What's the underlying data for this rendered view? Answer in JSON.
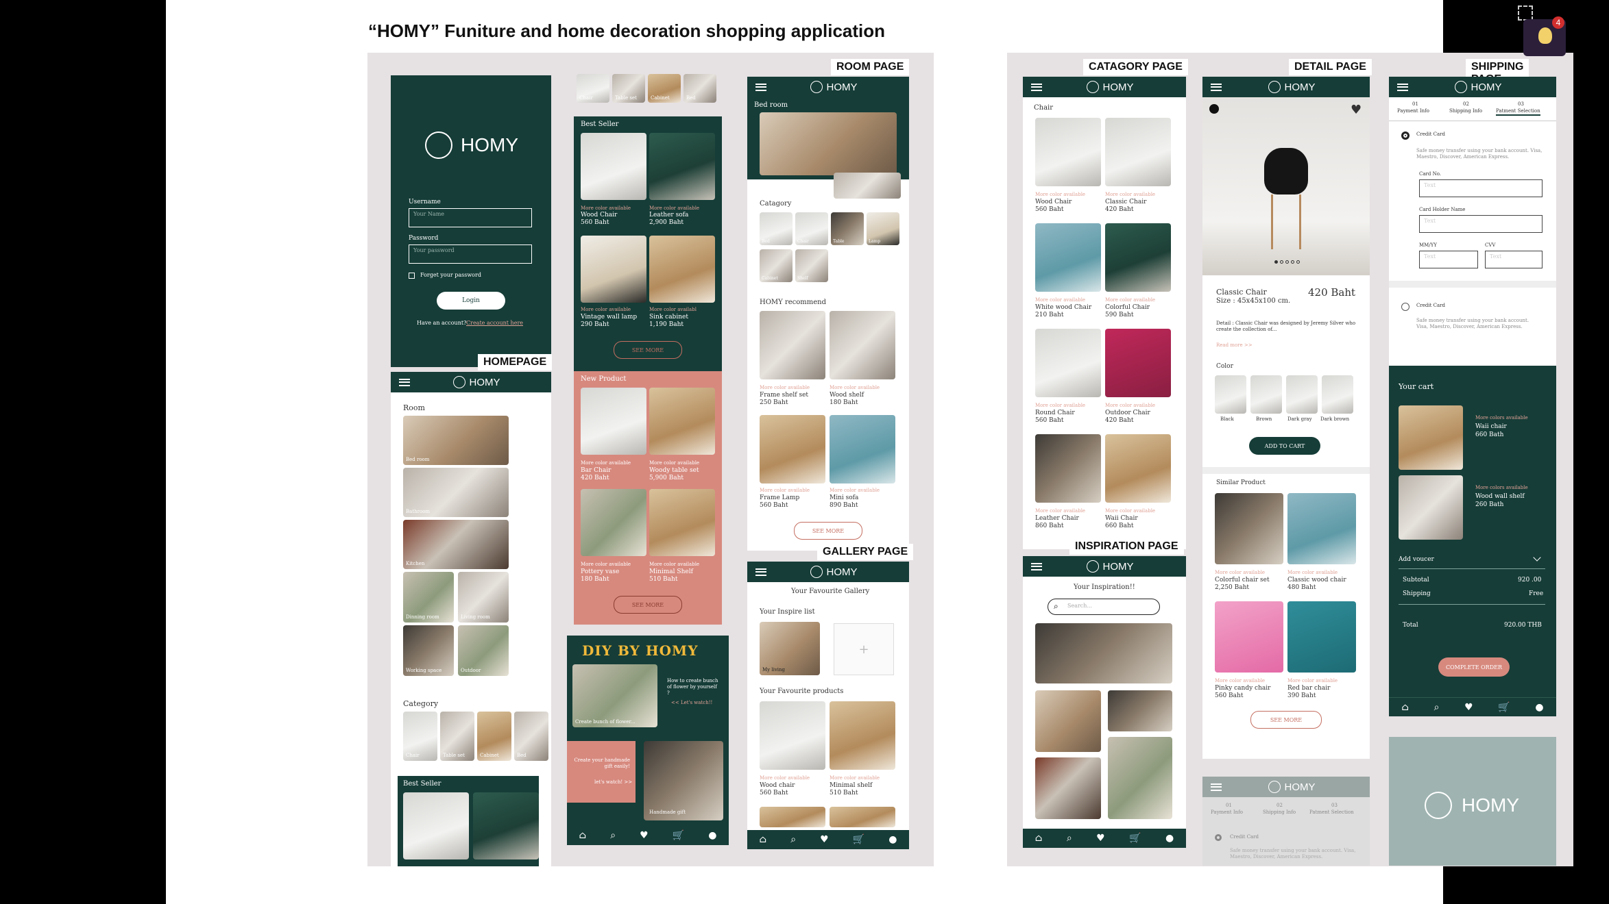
{
  "headline": "“HOMY” Funiture and home decoration shopping application",
  "brand": "HOMY",
  "notification_count": "4",
  "icons": {
    "menu": "☰",
    "home": "⌂",
    "search": "⌕",
    "heart": "♥",
    "cart": "🛒",
    "user": "●"
  },
  "tags": {
    "homepage": "HOMEPAGE",
    "room": "ROOM PAGE",
    "gallery": "GALLERY PAGE",
    "category": "CATAGORY  PAGE",
    "detail": "DETAIL PAGE",
    "shipping": "SHIPPING PAGE",
    "inspiration": "INSPIRATION PAGE"
  },
  "login": {
    "username_label": "Username",
    "username_placeholder": "Your Name",
    "password_label": "Password",
    "password_placeholder": "Your password",
    "remember": "Forget your password",
    "login_button": "Login",
    "no_account": "Have an account?",
    "create": "Create account here"
  },
  "home": {
    "room_title": "Room",
    "rooms": [
      "Bed room",
      "Bathroom",
      "Kitchen",
      "Dinning room",
      "Living room",
      "Working space",
      "Outdoor"
    ],
    "category_title": "Category",
    "categories": [
      "Chair",
      "Table set",
      "Cabinet",
      "Bed"
    ],
    "best_seller": "Best Seller"
  },
  "col2": {
    "top_categories": [
      "Chair",
      "Table set",
      "Cabinet",
      "Bed"
    ],
    "best_seller": "Best Seller",
    "more_color": "More color available",
    "more_color_short": "More color availabl",
    "bs_items": [
      {
        "name": "Wood Chair",
        "price": "560 Baht"
      },
      {
        "name": "Leather sofa",
        "price": "2,900 Baht"
      },
      {
        "name": "Vintage wall lamp",
        "price": "290 Baht"
      },
      {
        "name": "Sink cabinet",
        "price": "1,190 Baht"
      }
    ],
    "see_more": "SEE MORE",
    "new_product": "New Product",
    "np_items": [
      {
        "name": "Bar Chair",
        "price": "420 Baht"
      },
      {
        "name": "Woody table set",
        "price": "5,900 Baht"
      },
      {
        "name": "Pottery vase",
        "price": "180 Baht"
      },
      {
        "name": "Minimal Shelf",
        "price": "510 Baht"
      }
    ],
    "diy_title": "DIY BY HOMY",
    "diy_flower": "Create bunch of flower...",
    "diy_how": "How to create bunch of flower by yourself ?",
    "diy_watch": "<< Let's watch!!",
    "diy_gift": "Create your handmade gift easily!",
    "diy_gift_link": "let's watch! >>",
    "handmade": "Handmade gift"
  },
  "roompage": {
    "title": "Bed room",
    "category_title": "Catagory",
    "categories": [
      "Bed",
      "Chair",
      "Table",
      "Lamp",
      "Cabinet",
      "Shelf"
    ],
    "recommend_title": "HOMY recommend",
    "items": [
      {
        "name": "Frame shelf set",
        "price": "250 Baht"
      },
      {
        "name": "Wood shelf",
        "price": "180 Baht"
      },
      {
        "name": "Frame Lamp",
        "price": "560 Baht"
      },
      {
        "name": "Mini sofa",
        "price": "890 Baht"
      }
    ]
  },
  "gallery": {
    "title": "Your Favourite Gallery",
    "inspire_list": "Your Inspire list",
    "my_living": "My living",
    "fav_products": "Your Favourite products",
    "items": [
      {
        "name": "Wood chair",
        "price": "560 Baht"
      },
      {
        "name": "Minimal shelf",
        "price": "510 Baht"
      }
    ]
  },
  "category": {
    "title": "Chair",
    "items": [
      {
        "name": "Wood Chair",
        "price": "560 Baht"
      },
      {
        "name": "Classic Chair",
        "price": "420 Baht"
      },
      {
        "name": "White wood Chair",
        "price": "210 Baht"
      },
      {
        "name": "Colorful Chair",
        "price": "590 Baht"
      },
      {
        "name": "Round Chair",
        "price": "560 Baht"
      },
      {
        "name": "Outdoor Chair",
        "price": "420 Baht"
      },
      {
        "name": "Leather Chair",
        "price": "860 Baht"
      },
      {
        "name": "Waii Chair",
        "price": "660 Baht"
      }
    ]
  },
  "inspiration": {
    "title": "Your Inspiration!!",
    "search_placeholder": "Search..."
  },
  "detail": {
    "name": "Classic Chair",
    "price": "420 Baht",
    "size": "Size : 45x45x100 cm.",
    "desc": "Detail : Classic Chair was designed by Jeremy Silver who create the collection of...",
    "read_more": "Read more >>",
    "color_title": "Color",
    "colors": [
      "Black",
      "Brown",
      "Dark gray",
      "Dark brown"
    ],
    "add_to_cart": "ADD TO CART",
    "similar_title": "Similar Product",
    "similar": [
      {
        "name": "Colorful chair set",
        "price": "2,250 Baht"
      },
      {
        "name": "Classic wood chair",
        "price": "480 Baht"
      },
      {
        "name": "Pinky candy chair",
        "price": "560 Baht"
      },
      {
        "name": "Red bar chair",
        "price": "390 Baht"
      }
    ]
  },
  "shipping": {
    "steps": [
      {
        "num": "01",
        "label": "Payment Info"
      },
      {
        "num": "02",
        "label": "Shipping Info"
      },
      {
        "num": "03",
        "label": "Patment Selection"
      }
    ],
    "credit": "Credit Card",
    "credit_desc": "Safe money transfer using your bank account. Visa, Maestro, Discover, American Express.",
    "card_no": "Card No.",
    "card_holder": "Card Holder Name",
    "mmyy": "MM/YY",
    "cvv": "CVV",
    "input_hint": "Text",
    "cart_title": "Your cart",
    "cart_more": "More colors available",
    "cart_items": [
      {
        "name": "Waii chair",
        "price": "660 Bath"
      },
      {
        "name": "Wood wall shelf",
        "price": "260 Bath"
      }
    ],
    "voucher": "Add voucer",
    "subtotal_label": "Subtotal",
    "subtotal": "920 .00",
    "shipping_label": "Shipping",
    "shipping_val": "Free",
    "total_label": "Total",
    "total": "920.00  THB",
    "complete": "COMPLETE ORDER"
  }
}
